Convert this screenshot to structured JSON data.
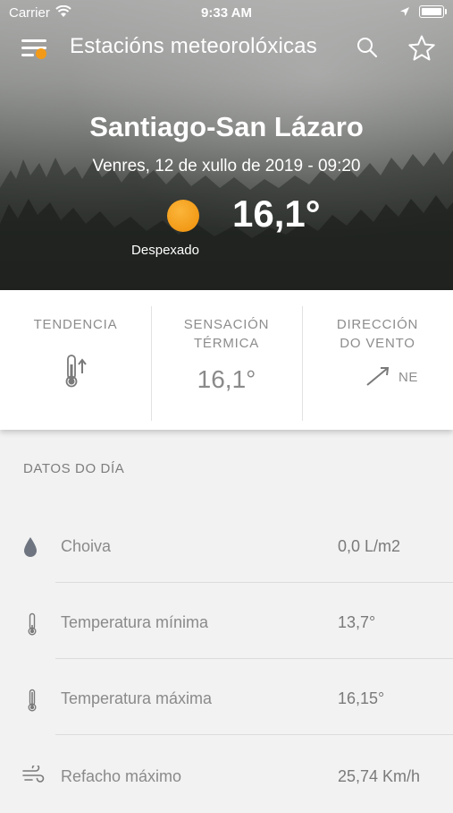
{
  "status_bar": {
    "carrier": "Carrier",
    "time": "9:33 AM"
  },
  "nav": {
    "title": "Estacións meteorolóxicas"
  },
  "hero": {
    "city": "Santiago-San Lázaro",
    "datetime": "Venres, 12 de xullo  de 2019 - 09:20",
    "temperature": "16,1°",
    "condition": "Despexado",
    "condition_icon": "sun-icon"
  },
  "summary": {
    "trend": {
      "label_line1": "TENDENCIA",
      "icon": "thermometer-up-icon"
    },
    "feels_like": {
      "label_line1": "SENSACIÓN",
      "label_line2": "TÉRMICA",
      "value": "16,1°"
    },
    "wind_dir": {
      "label_line1": "DIRECCIÓN",
      "label_line2": "DO VENTO",
      "value": "NE"
    }
  },
  "day_data": {
    "title": "DATOS DO DÍA",
    "rows": [
      {
        "label": "Choiva",
        "value": "0,0 L/m2",
        "icon": "raindrop-icon"
      },
      {
        "label": "Temperatura mínima",
        "value": "13,7°",
        "icon": "thermometer-low-icon"
      },
      {
        "label": "Temperatura máxima",
        "value": "16,15°",
        "icon": "thermometer-high-icon"
      },
      {
        "label": "Refacho máximo",
        "value": "25,74 Km/h",
        "icon": "wind-icon"
      }
    ]
  },
  "colors": {
    "accent": "#f29a17",
    "text_muted": "#8a8a8a"
  }
}
